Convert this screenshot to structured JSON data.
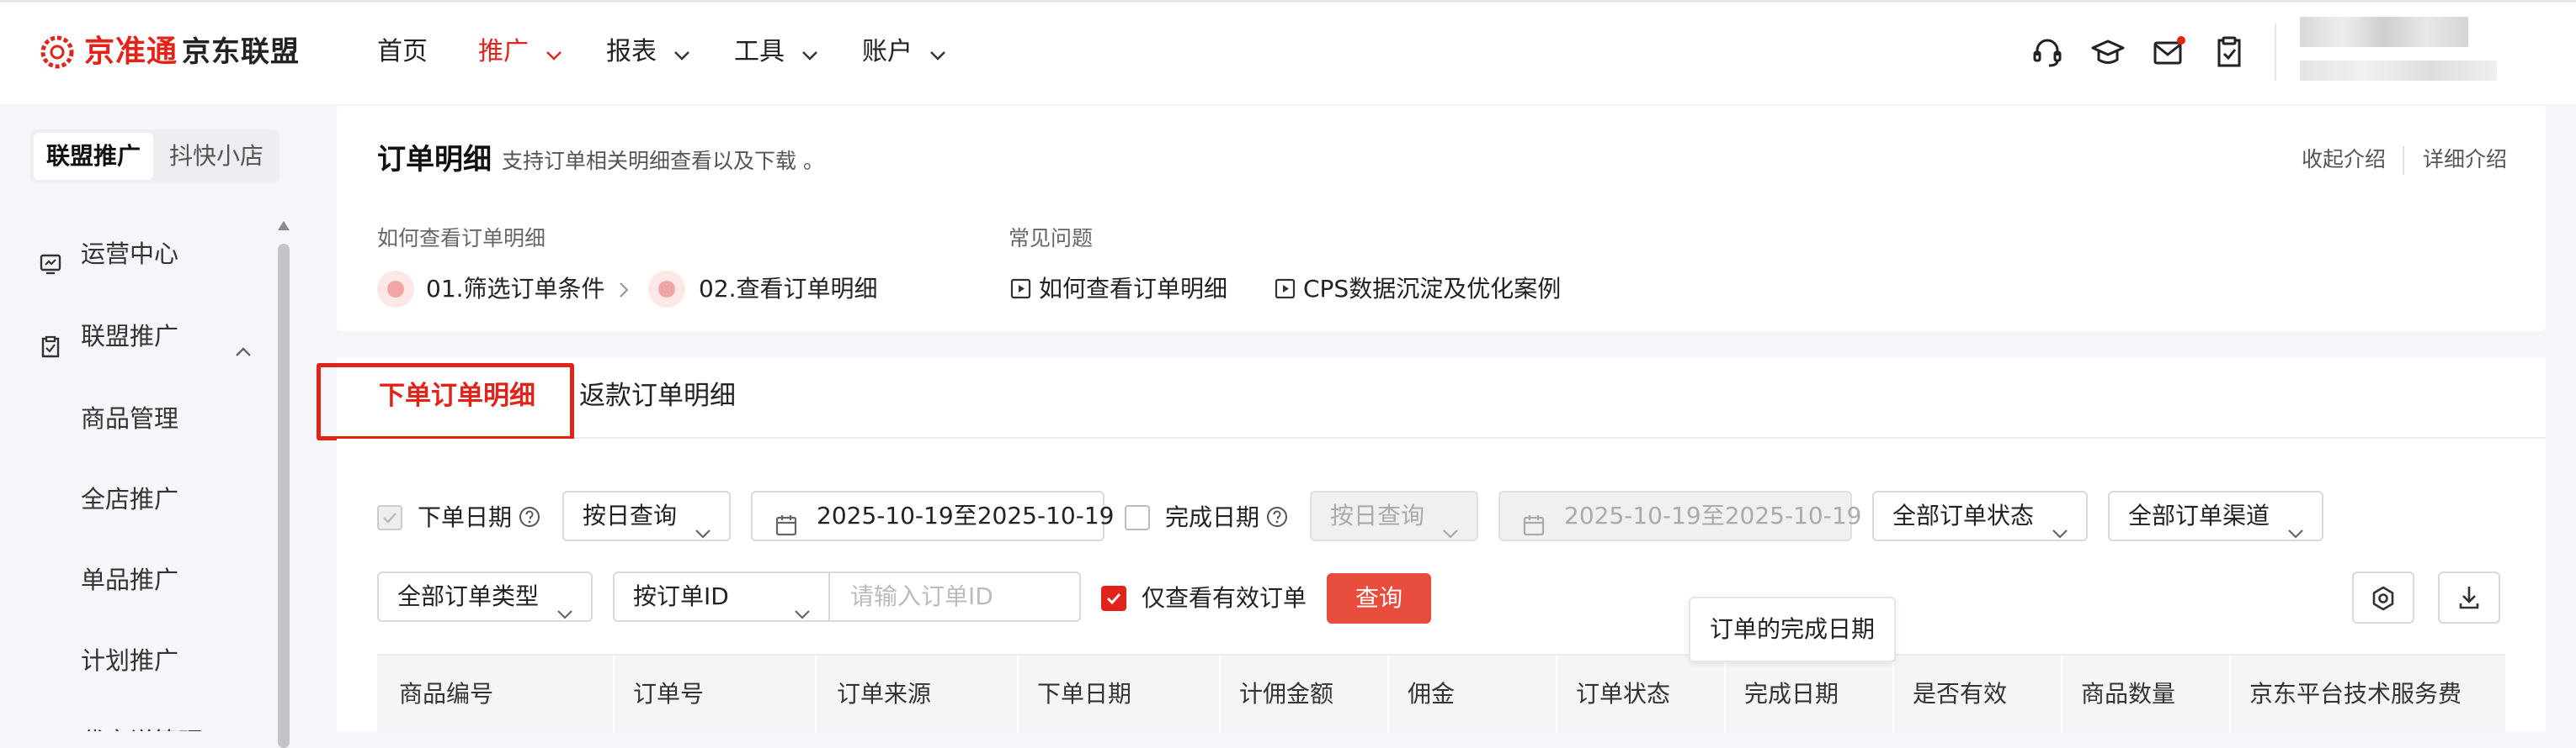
{
  "brand": {
    "logo_text": "京准通",
    "product_name": "京东联盟",
    "accent": "#e2231a"
  },
  "top_nav": [
    {
      "label": "首页",
      "dropdown": false,
      "active": false
    },
    {
      "label": "推广",
      "dropdown": true,
      "active": true
    },
    {
      "label": "报表",
      "dropdown": true,
      "active": false
    },
    {
      "label": "工具",
      "dropdown": true,
      "active": false
    },
    {
      "label": "账户",
      "dropdown": true,
      "active": false
    }
  ],
  "toolbar_icons": [
    "headset-icon",
    "graduation-cap-icon",
    "mail-icon",
    "clipboard-check-icon"
  ],
  "sidebar": {
    "tabs": [
      "联盟推广",
      "抖快小店"
    ],
    "items": [
      {
        "label": "运营中心",
        "icon": "dashboard-icon"
      },
      {
        "label": "联盟推广",
        "icon": "clipboard-icon",
        "expanded": true
      },
      {
        "label": "商品管理"
      },
      {
        "label": "全店推广"
      },
      {
        "label": "单品推广"
      },
      {
        "label": "计划推广"
      },
      {
        "label": "代言说管理"
      }
    ]
  },
  "intro": {
    "title": "订单明细",
    "subtitle": "支持订单相关明细查看以及下载 。",
    "collapse_label": "收起介绍",
    "detail_label": "详细介绍",
    "how_to_heading": "如何查看订单明细",
    "steps": [
      "01.筛选订单条件",
      "02.查看订单明细"
    ],
    "faq_heading": "常见问题",
    "faq_links": [
      "如何查看订单明细",
      "CPS数据沉淀及优化案例"
    ]
  },
  "tabs": {
    "active": "下单订单明细",
    "other": "返款订单明细"
  },
  "filters": {
    "order_date_label": "下单日期",
    "order_date_mode": "按日查询",
    "order_date_range": "2025-10-19至2025-10-19",
    "complete_date_label": "完成日期",
    "complete_date_mode": "按日查询",
    "complete_date_range": "2025-10-19至2025-10-19",
    "order_status": "全部订单状态",
    "order_channel": "全部订单渠道",
    "order_type": "全部订单类型",
    "id_mode": "按订单ID",
    "id_placeholder": "请输入订单ID",
    "valid_only_label": "仅查看有效订单",
    "query_button": "查询"
  },
  "tooltip": "订单的完成日期",
  "table": {
    "columns": [
      "商品编号",
      "订单号",
      "订单来源",
      "下单日期",
      "计佣金额",
      "佣金",
      "订单状态",
      "完成日期",
      "是否有效",
      "商品数量",
      "京东平台技术服务费"
    ]
  }
}
